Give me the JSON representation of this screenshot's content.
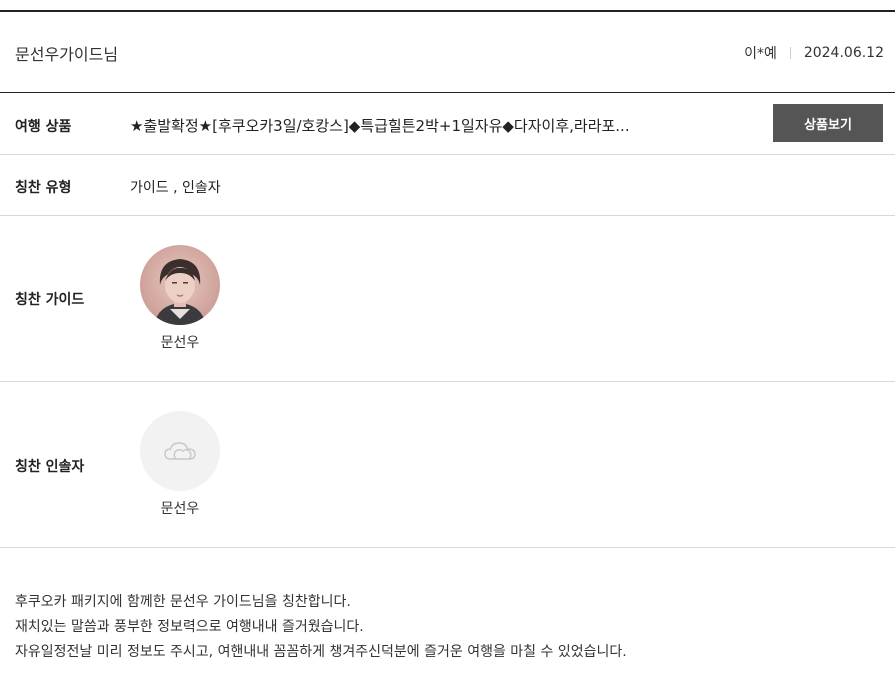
{
  "header": {
    "title": "문선우가이드님",
    "author": "이*예",
    "date": "2024.06.12"
  },
  "product": {
    "label": "여행 상품",
    "value": "★출발확정★[후쿠오카3일/호캉스]◆특급힐튼2박+1일자유◆다자이후,라라포...",
    "button": "상품보기"
  },
  "praise_type": {
    "label": "칭찬 유형",
    "value": "가이드 , 인솔자"
  },
  "guide": {
    "label": "칭찬 가이드",
    "name": "문선우"
  },
  "leader": {
    "label": "칭찬 인솔자",
    "name": "문선우"
  },
  "content": {
    "lines": [
      "후쿠오카 패키지에 함께한 문선우 가이드님을 칭찬합니다.",
      "재치있는 말씀과 풍부한 정보력으로 여행내내 즐거웠습니다.",
      "자유일정전날 미리 정보도 주시고, 여핸내내 꼼꼼하게 챙겨주신덕분에 즐거운 여행을 마칠 수 있었습니다."
    ]
  },
  "colors": {
    "button_bg": "#555555",
    "avatar_placeholder_bg": "#f2f2f2"
  },
  "icons": {
    "leader_placeholder": "cloud-icon"
  }
}
